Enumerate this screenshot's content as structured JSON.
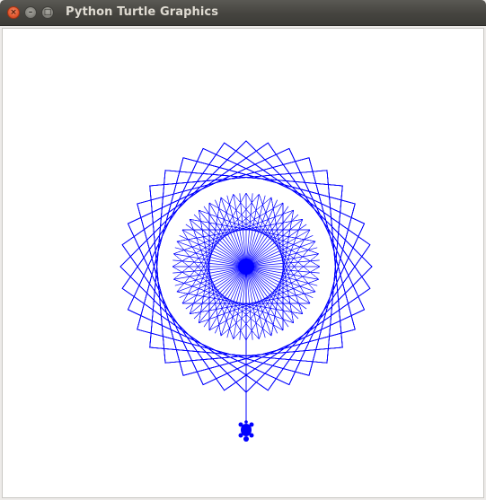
{
  "window": {
    "title": "Python Turtle Graphics",
    "close_glyph": "×",
    "minimize_glyph": "–",
    "maximize_glyph": "□"
  },
  "drawing": {
    "pen_color": "#0000ff",
    "background": "#ffffff",
    "turtle_shape": "turtle",
    "pattern": "rotated-squares-with-rays"
  }
}
